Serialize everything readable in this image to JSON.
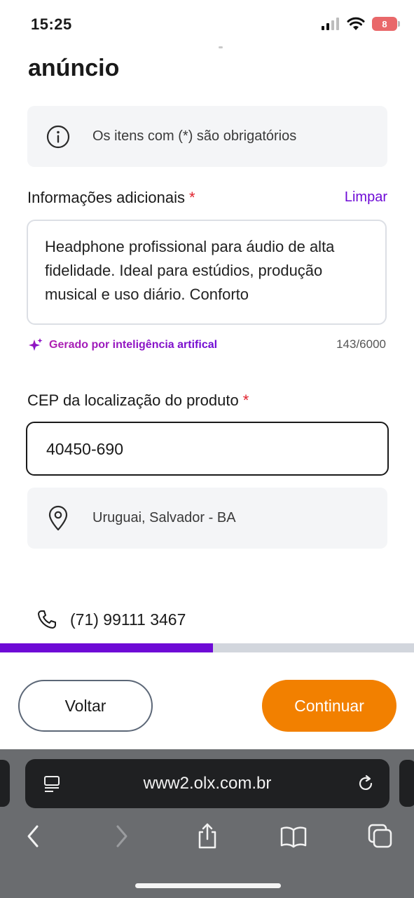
{
  "status_bar": {
    "time": "15:25",
    "battery": "8"
  },
  "page": {
    "heading": "anúncio"
  },
  "info": {
    "text": "Os itens com (*) são obrigatórios"
  },
  "additional_info": {
    "label": "Informações adicionais",
    "required_mark": "*",
    "clear_label": "Limpar",
    "value": "Headphone profissional para áudio de alta fidelidade. Ideal para estúdios, produção musical e uso diário. Conforto",
    "ai_note": "Gerado por inteligência artifical",
    "char_count": "143/6000"
  },
  "cep": {
    "label": "CEP da localização do produto",
    "required_mark": "*",
    "value": "40450-690",
    "location": "Uruguai, Salvador - BA"
  },
  "contact": {
    "phone": "(71) 99111 3467"
  },
  "progress": {
    "fraction": 0.515,
    "fill_color": "#6e0ad6"
  },
  "actions": {
    "back_label": "Voltar",
    "continue_label": "Continuar",
    "continue_color": "#f28000"
  },
  "browser": {
    "url": "www2.olx.com.br"
  },
  "icons": {
    "info": "info-circle-icon",
    "location": "map-pin-icon",
    "phone": "phone-icon",
    "sparkle": "sparkle-icon",
    "reader": "reader-mode-icon",
    "reload": "reload-icon",
    "back": "chevron-left-icon",
    "forward": "chevron-right-icon",
    "share": "share-icon",
    "bookmarks": "book-icon",
    "tabs": "tabs-icon"
  }
}
